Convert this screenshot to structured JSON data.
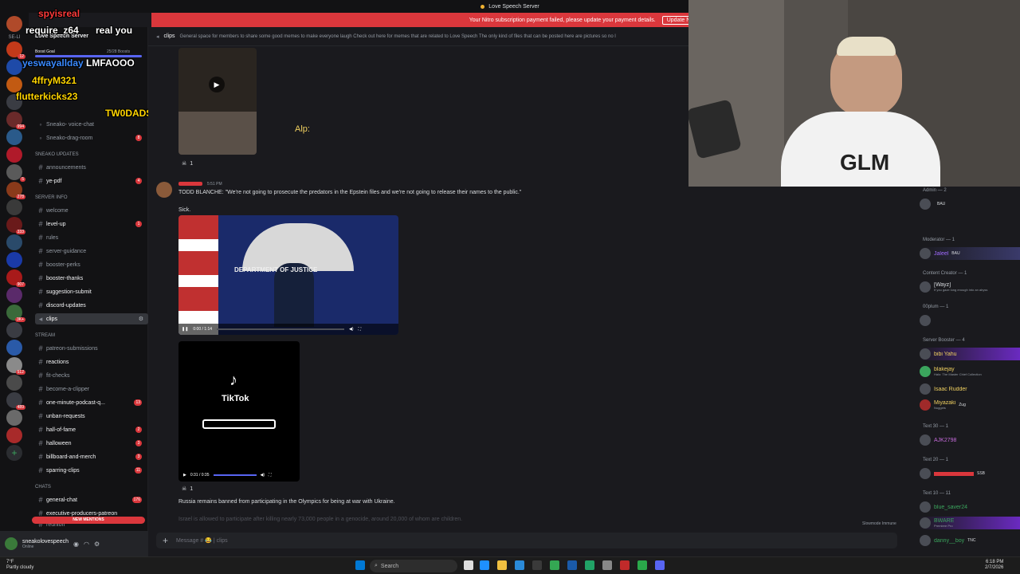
{
  "window": {
    "title": "Love Speech Server"
  },
  "banner": {
    "text": "Your Nitro subscription payment failed, please update your payment details.",
    "button": "Update Now"
  },
  "server": {
    "name": "Love Speech Server",
    "boost_goal": "Boost Goal",
    "boost_count": "25/28 Boosts"
  },
  "overlay_chat": [
    {
      "user": "spyisreal",
      "msg": ""
    },
    {
      "user": "require_z64",
      "msg": "real you"
    },
    {
      "user": "yeswayallday",
      "msg": "LMFAOOO"
    },
    {
      "user": "4ffryM321",
      "msg": ""
    },
    {
      "user": "flutterkicks23",
      "msg": ""
    },
    {
      "user": "TW0DADS",
      "msg": ""
    }
  ],
  "channels": {
    "items": [
      {
        "name": "Sneako- voice-chat"
      },
      {
        "name": "Sneako-drag-room",
        "count": "8"
      },
      {
        "name": "announcements"
      },
      {
        "name": "ye-pdf",
        "count": "4"
      },
      {
        "name": "welcome"
      },
      {
        "name": "level-up",
        "count": "1"
      },
      {
        "name": "rules"
      },
      {
        "name": "server-guidance"
      },
      {
        "name": "booster-perks"
      },
      {
        "name": "booster-thanks"
      },
      {
        "name": "suggestion-submit"
      },
      {
        "name": "discord-updates"
      },
      {
        "name": "clips"
      },
      {
        "name": "patreon-submissions"
      },
      {
        "name": "reactions"
      },
      {
        "name": "fit-checks"
      },
      {
        "name": "become-a-clipper"
      },
      {
        "name": "one-minute-podcast-q...",
        "count": "13"
      },
      {
        "name": "unban-requests"
      },
      {
        "name": "hall-of-fame",
        "count": "2"
      },
      {
        "name": "halloween",
        "count": "3"
      },
      {
        "name": "billboard-and-merch",
        "count": "3"
      },
      {
        "name": "sparring-clips",
        "count": "11"
      },
      {
        "name": "general-chat",
        "count": "176"
      },
      {
        "name": "executive-producers-patreon"
      },
      {
        "name": "reunion"
      }
    ],
    "categories": [
      "SNEAKO UPDATES",
      "SERVER INFO",
      "STREAM",
      "CHATS"
    ],
    "new_mentions": "NEW MENTIONS"
  },
  "user": {
    "name": "sneakolovespeech",
    "status": "Online"
  },
  "chat": {
    "channel": "clips",
    "topic": "General space for members to share some good memes to make everyone laugh Check out here for memes that are related to Love Speech The only kind of files that can be posted here are pictures so no l",
    "alp_label": "Alp:",
    "msg1_time": "5:51 PM",
    "msg1_text": "TODD BLANCHE: \"We're not going to prosecute the predators in the Epstein files and we're not going to release their names to the public.\"",
    "msg1_sub": "Sick.",
    "video1_time": "0:00 / 1:14",
    "tiktok_label": "TikTok",
    "video2_time": "0:31 / 0:35",
    "react1": "1",
    "react2": "1",
    "msg2_text": "Russia remains banned from participating in the Olympics for being at war with Ukraine.",
    "msg3_text": "Israel is allowed to participate after killing nearly 73,000 people in a genocide, around 20,000 of whom are children.",
    "slowmode": "Slowmode Immune",
    "composer_placeholder": "Message # 😂 | clips",
    "video_overlay_text": "DEPARTMENT OF JUSTICE"
  },
  "webcam": {
    "shirt": "GLM"
  },
  "members": {
    "categories": [
      "Admin — 2",
      "Moderator — 1",
      "Content Creator — 1",
      "00plum — 1",
      "Server Booster — 4",
      "Text 30 — 1",
      "Text 20 — 1",
      "Text 10 — 11"
    ],
    "list": [
      {
        "name": "",
        "tag": "BAU",
        "color": "#5865f2"
      },
      {
        "name": "Jaleel",
        "tag": "BAU",
        "color": "#a06bff"
      },
      {
        "name": "[Wayz]",
        "sub": "If you gaze long enough into an abyss",
        "color": "#dbdee1"
      },
      {
        "name": "",
        "color": "#dbdee1"
      },
      {
        "name": "bibi Yahu",
        "color": "#f0d060"
      },
      {
        "name": "blakejay",
        "sub": "Halo: The Master Chief Collection",
        "color": "#f0d060"
      },
      {
        "name": "Isaac Rudder",
        "color": "#f0d060"
      },
      {
        "name": "Miyazaki",
        "tag": "Zug",
        "sub": "Nuggets",
        "color": "#f0d060"
      },
      {
        "name": "AJK2798",
        "color": "#c46ad9"
      },
      {
        "name": "",
        "tag": "SSB",
        "color": "#da373c"
      },
      {
        "name": "blue_saver24",
        "color": "#3ba55d"
      },
      {
        "name": "BWARE",
        "sub": "Premiere Pro",
        "color": "#3ba55d"
      },
      {
        "name": "danny__boy",
        "tag": "TNC",
        "color": "#3ba55d"
      }
    ]
  },
  "taskbar": {
    "weather_temp": "7°F",
    "weather_text": "Partly cloudy",
    "search": "Search",
    "time": "6:18 PM",
    "date": "2/7/2026"
  }
}
